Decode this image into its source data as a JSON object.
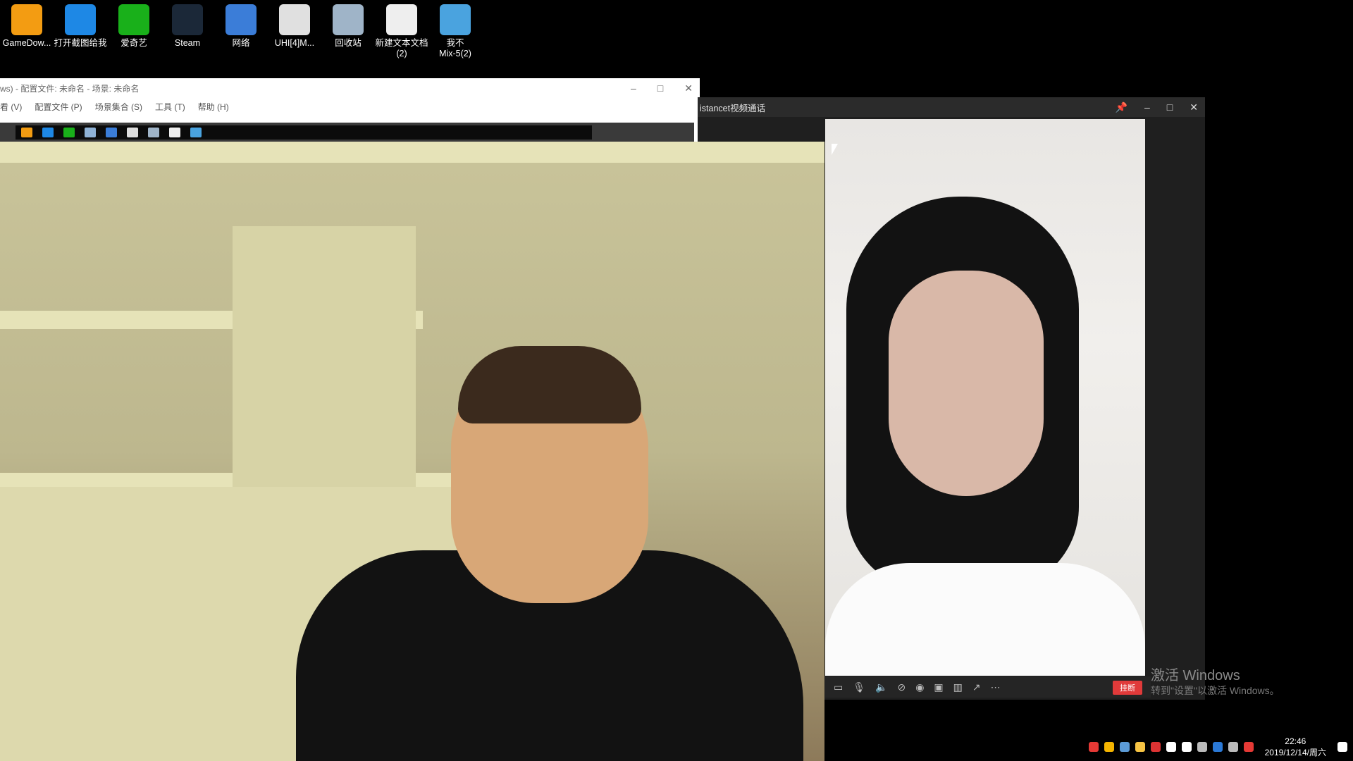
{
  "desktop_icons": [
    {
      "label": "GameDow...",
      "icon": "gamedownload-icon",
      "color": "#f39c12"
    },
    {
      "label": "打开截图给我",
      "icon": "teamviewer-icon",
      "color": "#1e88e5"
    },
    {
      "label": "爱奇艺",
      "icon": "iqiyi-icon",
      "color": "#19b01a"
    },
    {
      "label": "Steam",
      "icon": "steam-icon",
      "color": "#1b2838"
    },
    {
      "label": "网络",
      "icon": "network-icon",
      "color": "#3b7dd8"
    },
    {
      "label": "UHI[4]M...",
      "icon": "image-file-icon",
      "color": "#e0e0e0"
    },
    {
      "label": "回收站",
      "icon": "recycle-bin-icon",
      "color": "#9fb4c8"
    },
    {
      "label": "新建文本文档\n(2)",
      "icon": "text-file-icon",
      "color": "#eeeeee"
    },
    {
      "label": "我不\nMix-5(2)",
      "icon": "mp3-file-icon",
      "color": "#4aa3df"
    }
  ],
  "obs_window": {
    "title": "ws) - 配置文件: 未命名 - 场景: 未命名",
    "menu": [
      "看 (V)",
      "配置文件 (P)",
      "场景集合 (S)",
      "工具 (T)",
      "帮助 (H)"
    ],
    "controls": {
      "minimize": "–",
      "maximize": "□",
      "close": "✕"
    }
  },
  "call_window": {
    "title": "istancet视频通话",
    "controls": {
      "pin": "📌",
      "minimize": "–",
      "maximize": "□",
      "close": "✕"
    },
    "toolbar_icons": [
      "chat-icon",
      "mic-icon",
      "speaker-icon",
      "camera-off-icon",
      "snapshot-icon",
      "record-icon",
      "layout-icon",
      "share-icon",
      "more-icon"
    ],
    "hangup_label": "挂断"
  },
  "watermark": {
    "line1": "激活 Windows",
    "line2": "转到\"设置\"以激活 Windows。"
  },
  "taskbar": {
    "time": "22:46",
    "date": "2019/12/14/周六"
  }
}
